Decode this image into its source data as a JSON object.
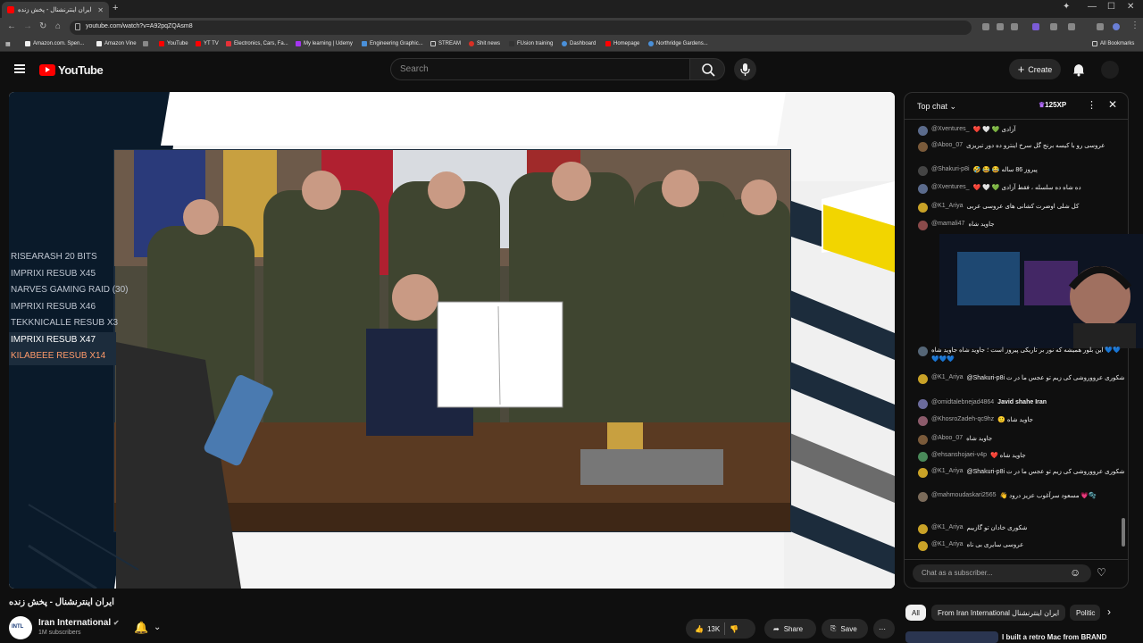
{
  "browser": {
    "tab_title": "ایران اینترنشنال - پخش زنده",
    "url": "youtube.com/watch?v=A92pqZQAsm8",
    "bookmarks": [
      {
        "label": "Amazon.com. Spen...",
        "color": "#f0f0f0"
      },
      {
        "label": "Amazon Vine",
        "color": "#f0f0f0"
      },
      {
        "label": "YouTube",
        "color": "#ff0000"
      },
      {
        "label": "YT TV",
        "color": "#ff0000"
      },
      {
        "label": "Electronics, Cars, Fa...",
        "color": "#e53238"
      },
      {
        "label": "My learning | Udemy",
        "color": "#a435f0"
      },
      {
        "label": "Engineering Graphic...",
        "color": "#4a90d9"
      },
      {
        "label": "STREAM",
        "color": "#cccccc"
      },
      {
        "label": "Shit news",
        "color": "#d93025"
      },
      {
        "label": "FUsion training",
        "color": "#333333"
      },
      {
        "label": "Dashboard",
        "color": "#4a90d9"
      },
      {
        "label": "Homepage",
        "color": "#ff0000"
      },
      {
        "label": "Northridge Gardens...",
        "color": "#4a90d9"
      }
    ],
    "all_bookmarks": "All Bookmarks"
  },
  "header": {
    "logo_text": "YouTube",
    "search_placeholder": "Search",
    "create_label": "Create"
  },
  "player": {
    "tickers": [
      {
        "text": "RISEARASH   20 BITS",
        "color": "#bfc6d1"
      },
      {
        "text": "IMPRIXI   RESUB X45",
        "color": "#bfc6d1"
      },
      {
        "text": "NARVES GAMING   RAID (30)",
        "color": "#bfc6d1"
      },
      {
        "text": "IMPRIXI   RESUB X46",
        "color": "#bfc6d1"
      },
      {
        "text": "TEKKNICALLE   RESUB X3",
        "color": "#bfc6d1"
      },
      {
        "text": "IMPRIXI   RESUB X47",
        "color": "#ffffff"
      },
      {
        "text": "KILABEEE   RESUB X14",
        "color": "#ff9a6a"
      }
    ]
  },
  "video": {
    "title": "ایران اینترنشنال - پخش زنده",
    "channel": "Iran International",
    "subscribers": "1M subscribers",
    "likes": "13K",
    "share_label": "Share",
    "save_label": "Save"
  },
  "chat": {
    "header_title": "Top chat",
    "xp": "125XP",
    "messages": [
      {
        "author": "@Xventures_",
        "text": "❤️ 🤍 💚 آزادی",
        "avatar_color": "#5b6b8c"
      },
      {
        "author": "@Aboo_07",
        "text": "عروسی رو با کیسه برنج گل سرخ اینترو ده دور تبریزی",
        "avatar_color": "#7a5a3a"
      },
      {
        "author": "@Shakuri-p8i",
        "text": "🤣 😂 😂 پیروز 86 ساله",
        "avatar_color": "#444444"
      },
      {
        "author": "@Xventures_",
        "text": "❤️ 🤍 💚 ده شاه ده سلسله ، فقط آزادی",
        "avatar_color": "#5b6b8c"
      },
      {
        "author": "@K1_Ariya",
        "text": "کل شلی اوضرت کشانی های عروسی عربی",
        "avatar_color": "#c9a227"
      },
      {
        "author": "@mamali47",
        "text": "جاوید شاه",
        "avatar_color": "#8a4a4a"
      },
      {
        "author": "",
        "text": "این بلور همیشه که نور بر تاریکی پیروز است ؛ جاوید شاه جاوید شاه 💙💙💙💙💙",
        "avatar_color": "#556677"
      },
      {
        "author": "@K1_Ariya",
        "text": "@Shakuri-p8i شکوری عرووروشی کی زیم تو عجس ما در ت",
        "avatar_color": "#c9a227"
      },
      {
        "author": "@omidtalebnejad4864",
        "text": "Javid shahe Iran",
        "avatar_color": "#6b6b9c"
      },
      {
        "author": "@KhosroZadeh-qc9hz",
        "text": "🙂 جاوید شاه",
        "avatar_color": "#8c5b6b"
      },
      {
        "author": "@Aboo_07",
        "text": "جاوید شاه",
        "avatar_color": "#7a5a3a"
      },
      {
        "author": "@ehsanshojaei-v4p",
        "text": "❤️ جاوید شاه",
        "avatar_color": "#4a8a5a"
      },
      {
        "author": "@K1_Ariya",
        "text": "@Shakuri-p8i شکوری عرووروشی کی زیم تو عجس ما در ت",
        "avatar_color": "#c9a227"
      },
      {
        "author": "@mahmoudaskari2565",
        "text": "👋 مسعود سرآغوب عزیز درود 💗🫧",
        "avatar_color": "#7b6b5a"
      },
      {
        "author": "@K1_Ariya",
        "text": "شکوری خادان تو گازیبم",
        "avatar_color": "#c9a227"
      },
      {
        "author": "@K1_Ariya",
        "text": "عروسی سایری بی ناه",
        "avatar_color": "#c9a227"
      }
    ],
    "input_placeholder": "Chat as a subscriber..."
  },
  "chips": [
    {
      "label": "All"
    },
    {
      "label": "From Iran International ایران اینترنشنال"
    },
    {
      "label": "Politic"
    }
  ],
  "recommendation_title": "I built a retro Mac from BRAND"
}
